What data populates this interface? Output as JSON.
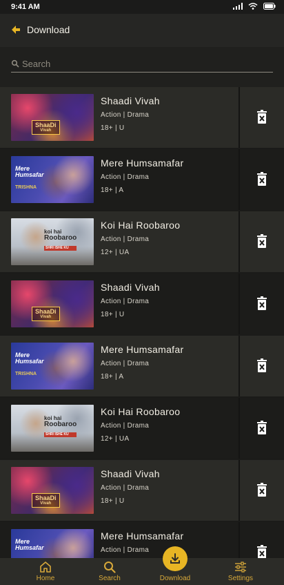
{
  "status": {
    "time": "9:41 AM"
  },
  "header": {
    "title": "Download"
  },
  "search": {
    "placeholder": "Search",
    "value": ""
  },
  "items": [
    {
      "title": "Shaadi Vivah",
      "genre": "Action  |  Drama",
      "rating": "18+  |  U",
      "thumb": {
        "style": "a",
        "text_line1": "ShaaDi",
        "text_line2": "Vivah"
      }
    },
    {
      "title": "Mere Humsamafar",
      "genre": "Action  |  Drama",
      "rating": "18+  |  A",
      "thumb": {
        "style": "b",
        "text_line1": "Mere",
        "text_line2": "Humsafar",
        "tagline": "TRISHNA"
      }
    },
    {
      "title": "Koi Hai Roobaroo",
      "genre": "Action  |  Drama",
      "rating": "12+  |  UA",
      "thumb": {
        "style": "c",
        "text_line1": "koi hai",
        "text_line2": "Roobaroo",
        "tagline": "SHRI ISHE KU"
      }
    },
    {
      "title": "Shaadi Vivah",
      "genre": "Action  |  Drama",
      "rating": "18+  |  U",
      "thumb": {
        "style": "a",
        "text_line1": "ShaaDi",
        "text_line2": "Vivah"
      }
    },
    {
      "title": "Mere Humsamafar",
      "genre": "Action  |  Drama",
      "rating": "18+  |  A",
      "thumb": {
        "style": "b",
        "text_line1": "Mere",
        "text_line2": "Humsafar",
        "tagline": "TRISHNA"
      }
    },
    {
      "title": "Koi Hai Roobaroo",
      "genre": "Action  |  Drama",
      "rating": "12+  |  UA",
      "thumb": {
        "style": "c",
        "text_line1": "koi hai",
        "text_line2": "Roobaroo",
        "tagline": "SHRI ISHE KU"
      }
    },
    {
      "title": "Shaadi Vivah",
      "genre": "Action  |  Drama",
      "rating": "18+  |  U",
      "thumb": {
        "style": "a",
        "text_line1": "ShaaDi",
        "text_line2": "Vivah"
      }
    },
    {
      "title": "Mere Humsamafar",
      "genre": "Action  |  Drama",
      "rating": "",
      "thumb": {
        "style": "b",
        "text_line1": "Mere",
        "text_line2": "Humsafar",
        "tagline": ""
      }
    }
  ],
  "nav": [
    {
      "label": "Home",
      "icon": "home-icon"
    },
    {
      "label": "Search",
      "icon": "search-icon"
    },
    {
      "label": "Download",
      "icon": "download-icon",
      "active": true
    },
    {
      "label": "Settings",
      "icon": "settings-icon"
    }
  ],
  "colors": {
    "accent": "#e7b524",
    "background": "#1b1b19",
    "row_alt": "#2b2b27"
  }
}
